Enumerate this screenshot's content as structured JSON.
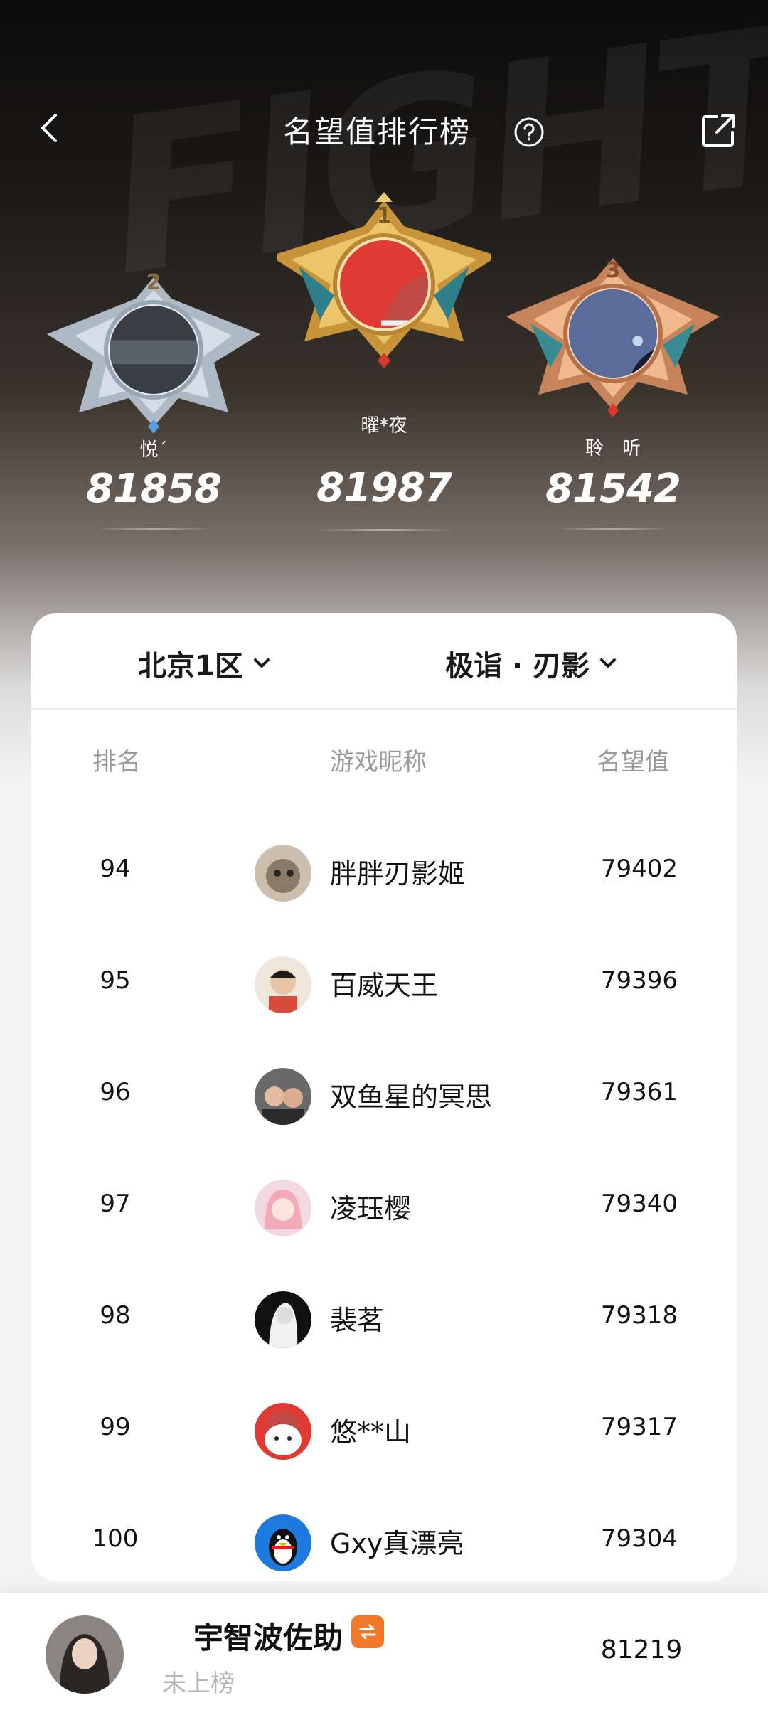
{
  "header": {
    "title": "名望值排行榜"
  },
  "podium": [
    {
      "rank": "2",
      "name": "悦´",
      "score": "81858"
    },
    {
      "rank": "1",
      "name": "曜*夜",
      "score": "81987"
    },
    {
      "rank": "3",
      "name": "聆　听",
      "score": "81542"
    }
  ],
  "filters": {
    "server": "北京1区",
    "role": "极诣 · 刃影"
  },
  "columns": {
    "rank": "排名",
    "nickname": "游戏昵称",
    "score": "名望值"
  },
  "rows": [
    {
      "rank": "94",
      "name": "胖胖刃影姬",
      "score": "79402"
    },
    {
      "rank": "95",
      "name": "百威天王",
      "score": "79396"
    },
    {
      "rank": "96",
      "name": "双鱼星的冥思",
      "score": "79361"
    },
    {
      "rank": "97",
      "name": "凌珏樱",
      "score": "79340"
    },
    {
      "rank": "98",
      "name": "裴茗",
      "score": "79318"
    },
    {
      "rank": "99",
      "name": "悠**山",
      "score": "79317"
    },
    {
      "rank": "100",
      "name": "Gxy真漂亮",
      "score": "79304"
    }
  ],
  "self": {
    "name": "宇智波佐助",
    "status": "未上榜",
    "score": "81219"
  },
  "colors": {
    "gold": "#e8b54a",
    "silver": "#b8c4d2",
    "bronze": "#e29b6b",
    "badge": "#f07a2a"
  }
}
